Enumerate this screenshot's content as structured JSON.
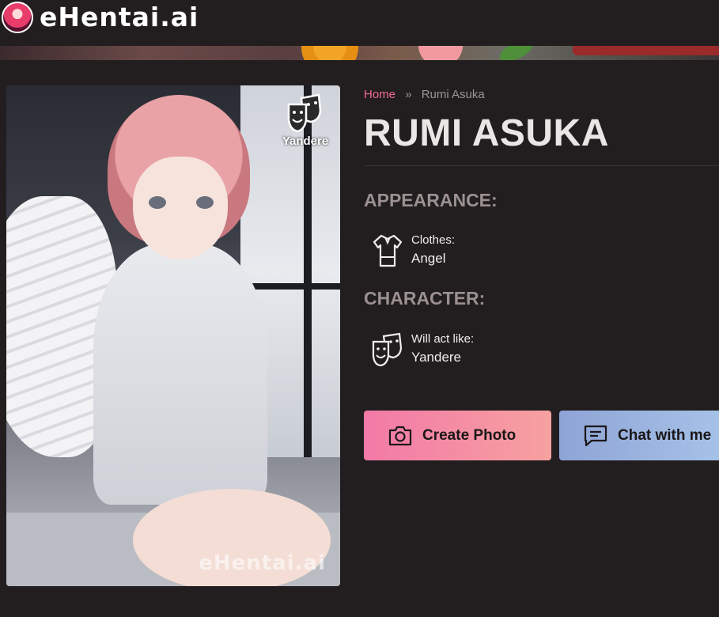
{
  "header": {
    "brand": "eHentai.ai",
    "avatar_icon": "anime-avatar-logo"
  },
  "portrait": {
    "badge_icon": "theater-masks-icon",
    "badge_label": "Yandere",
    "watermark": "eHentai.ai"
  },
  "breadcrumb": {
    "home": "Home",
    "separator": "»",
    "current": "Rumi Asuka"
  },
  "title": "RUMI ASUKA",
  "appearance": {
    "heading": "APPEARANCE:",
    "clothes_icon": "shirt-icon",
    "clothes_label": "Clothes:",
    "clothes_value": "Angel"
  },
  "character": {
    "heading": "CHARACTER:",
    "act_icon": "theater-masks-icon",
    "act_label": "Will act like:",
    "act_value": "Yandere"
  },
  "actions": {
    "create_photo_label": "Create Photo",
    "create_photo_icon": "camera-icon",
    "chat_label": "Chat with me",
    "chat_icon": "chat-bubble-icon"
  },
  "colors": {
    "background": "#221e1f",
    "accent_pink": "#f06a8f",
    "heading_muted": "#9c9091"
  }
}
